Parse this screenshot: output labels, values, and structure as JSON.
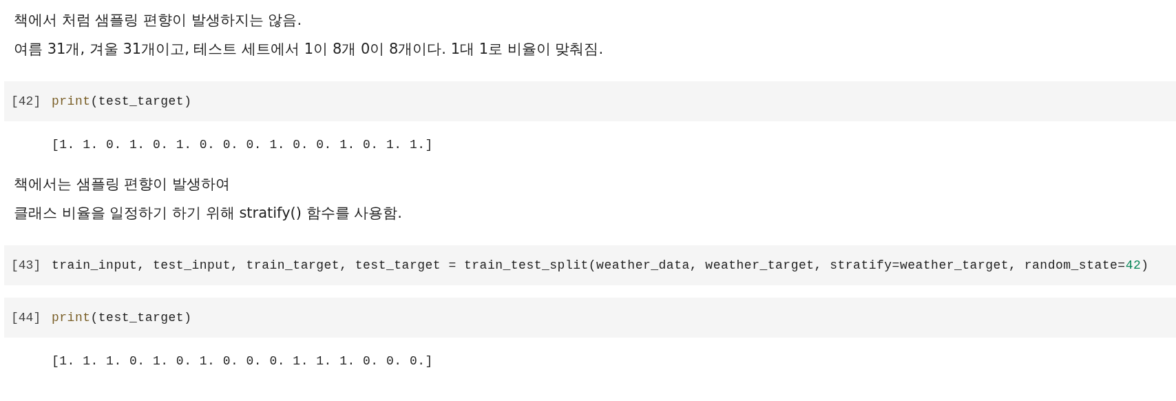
{
  "cells": [
    {
      "kind": "markdown",
      "lines": [
        "책에서 처럼 샘플링 편향이 발생하지는 않음.",
        "여름 31개, 겨울 31개이고, 테스트 세트에서 1이 8개 0이 8개이다. 1대 1로 비율이 맞춰짐."
      ]
    },
    {
      "kind": "code",
      "prompt": "[42]",
      "tokens": [
        {
          "kind": "builtin",
          "text": "print"
        },
        {
          "kind": "plain",
          "text": "(test_target)"
        }
      ],
      "output": "[1. 1. 0. 1. 0. 1. 0. 0. 0. 1. 0. 0. 1. 0. 1. 1.]"
    },
    {
      "kind": "markdown",
      "lines": [
        "책에서는 샘플링 편향이 발생하여",
        "클래스 비율을 일정하기 하기 위해 stratify() 함수를 사용함."
      ]
    },
    {
      "kind": "code",
      "prompt": "[43]",
      "tokens": [
        {
          "kind": "plain",
          "text": "train_input, test_input, train_target, test_target = train_test_split(weather_data, weather_target, stratify=weather_target, random_state="
        },
        {
          "kind": "number",
          "text": "42"
        },
        {
          "kind": "plain",
          "text": ")"
        }
      ]
    },
    {
      "kind": "code",
      "prompt": "[44]",
      "tokens": [
        {
          "kind": "builtin",
          "text": "print"
        },
        {
          "kind": "plain",
          "text": "(test_target)"
        }
      ],
      "output": "[1. 1. 1. 0. 1. 0. 1. 0. 0. 0. 1. 1. 1. 0. 0. 0.]"
    }
  ]
}
